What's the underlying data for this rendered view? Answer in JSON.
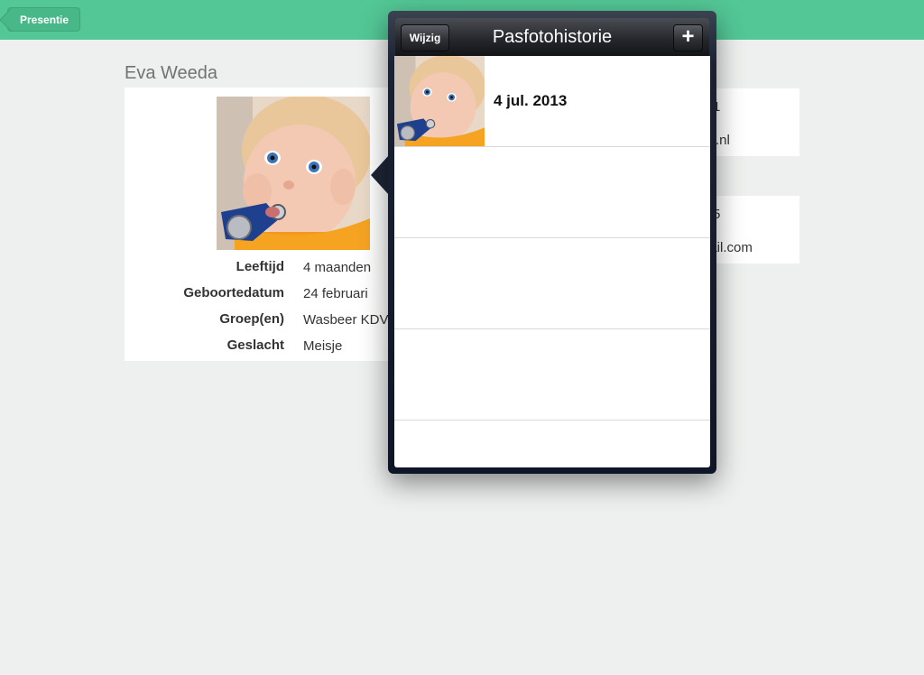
{
  "nav": {
    "back_label": "Presentie"
  },
  "child": {
    "name": "Eva Weeda",
    "details": [
      {
        "label": "Leeftijd",
        "value": "4 maanden"
      },
      {
        "label": "Geboortedatum",
        "value": "24 februari"
      },
      {
        "label": "Groep(en)",
        "value": "Wasbeer KDV"
      },
      {
        "label": "Geslacht",
        "value": "Meisje"
      }
    ]
  },
  "contacts": [
    {
      "line1": "1",
      "line2": "lio.nl"
    },
    {
      "line1": "5",
      "line2": "nail.com"
    }
  ],
  "popover": {
    "title": "Pasfotohistorie",
    "edit_label": "Wijzig",
    "add_label": "+",
    "items": [
      {
        "date": "4 jul. 2013"
      }
    ]
  },
  "colors": {
    "topbar": "#53c796",
    "background": "#eef0ef",
    "popover_frame": "#1a2233"
  }
}
